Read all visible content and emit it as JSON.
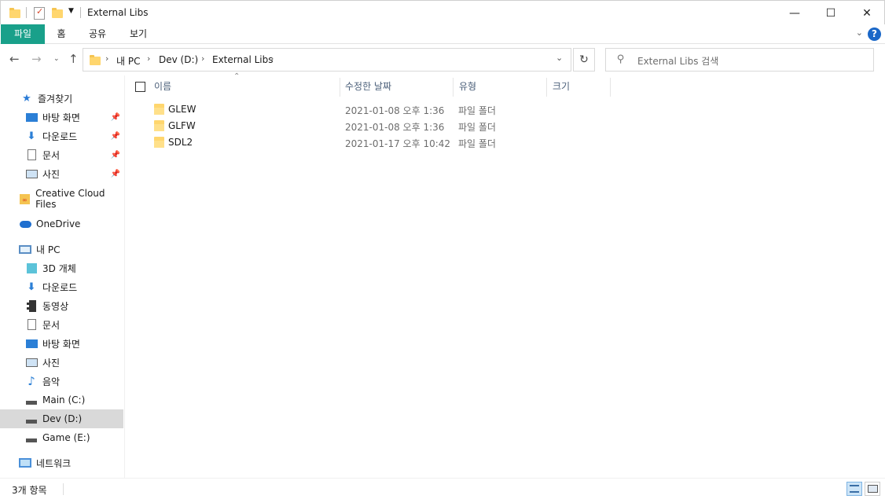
{
  "window": {
    "title": "External Libs",
    "minimize": "—",
    "maximize": "☐",
    "close": "✕"
  },
  "ribbon": {
    "tabs": [
      "파일",
      "홈",
      "공유",
      "보기"
    ],
    "help": "?"
  },
  "address": {
    "crumbs": [
      "내 PC",
      "Dev (D:)",
      "External Libs"
    ]
  },
  "search": {
    "placeholder": "External Libs 검색"
  },
  "nav": {
    "quick_access": "즐겨찾기",
    "quick_items": [
      "바탕 화면",
      "다운로드",
      "문서",
      "사진"
    ],
    "creative_cloud": "Creative Cloud Files",
    "onedrive": "OneDrive",
    "this_pc": "내 PC",
    "pc_items": [
      "3D 개체",
      "다운로드",
      "동영상",
      "문서",
      "바탕 화면",
      "사진",
      "음악",
      "Main (C:)",
      "Dev (D:)",
      "Game (E:)"
    ],
    "network": "네트워크"
  },
  "columns": {
    "name": "이름",
    "modified": "수정한 날짜",
    "type": "유형",
    "size": "크기"
  },
  "files": [
    {
      "name": "GLEW",
      "modified": "2021-01-08 오후 1:36",
      "type": "파일 폴더"
    },
    {
      "name": "GLFW",
      "modified": "2021-01-08 오후 1:36",
      "type": "파일 폴더"
    },
    {
      "name": "SDL2",
      "modified": "2021-01-17 오후 10:42",
      "type": "파일 폴더"
    }
  ],
  "status": {
    "count": "3개 항목"
  },
  "colors": {
    "file_tab": "#19a08a",
    "folder": "#ffd66e",
    "selection": "#d9d9d9",
    "header_text": "#4c607a"
  }
}
